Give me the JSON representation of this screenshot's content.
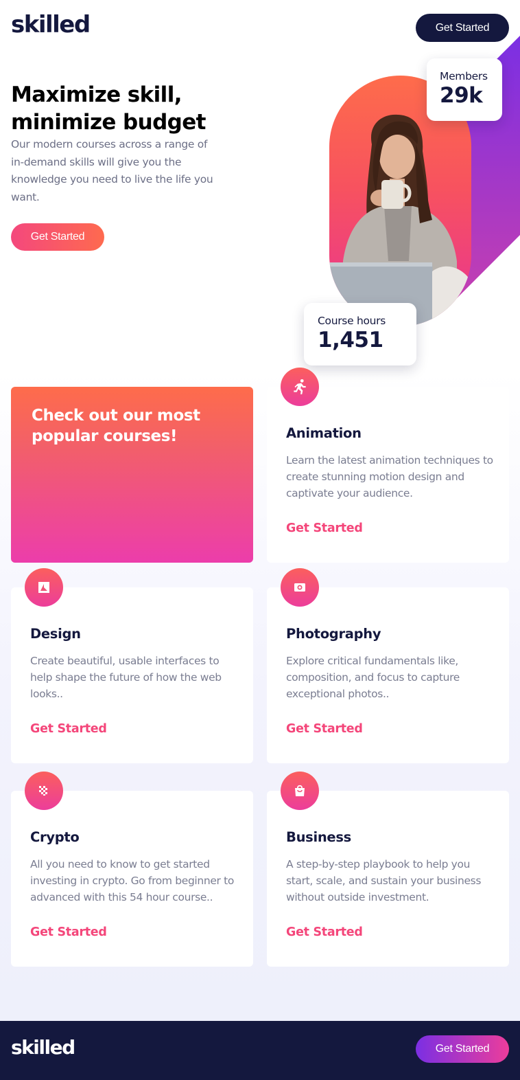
{
  "header": {
    "logo": "skilled",
    "cta_label": "Get Started"
  },
  "hero": {
    "title_line1": "Maximize skill,",
    "title_line2": "minimize budget",
    "description": "Our modern courses across a range of in-demand skills will give you the knowledge you need to live the life you want.",
    "cta_label": "Get Started",
    "image_alt": "Woman drinking from a mug in front of a laptop"
  },
  "stats": {
    "members_label": "Members",
    "members_value": "29k",
    "hours_label": "Course hours",
    "hours_value": "1,451"
  },
  "courses_section": {
    "promo_title": "Check out our most popular courses!",
    "courses": [
      {
        "icon": "running-person-icon",
        "title": "Animation",
        "description": "Learn the latest animation techniques to create stunning motion design and captivate your audience.",
        "link_label": "Get Started"
      },
      {
        "icon": "design-icon",
        "title": "Design",
        "description": "Create beautiful, usable interfaces to help shape the future of how the web looks..",
        "link_label": "Get Started"
      },
      {
        "icon": "camera-icon",
        "title": "Photography",
        "description": "Explore critical fundamentals like, composition, and focus to capture exceptional photos..",
        "link_label": "Get Started"
      },
      {
        "icon": "crypto-icon",
        "title": "Crypto",
        "description": "All you need to know to get started investing in crypto. Go from beginner to advanced with this 54 hour course..",
        "link_label": "Get Started"
      },
      {
        "icon": "shopping-bag-icon",
        "title": "Business",
        "description": "A step-by-step playbook to help you start, scale, and sustain your business without outside investment.",
        "link_label": "Get Started"
      }
    ]
  },
  "footer": {
    "logo": "skilled",
    "cta_label": "Get Started"
  },
  "colors": {
    "navy": "#14183e",
    "accent_pink": "#f4467a",
    "gradient_orange": "#fe6c4b",
    "gradient_magenta": "#ec3d9b",
    "purple": "#7b2fe3"
  }
}
